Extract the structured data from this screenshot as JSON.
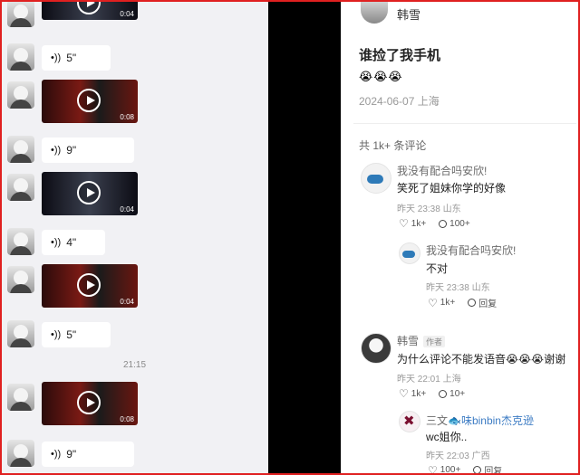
{
  "chat": {
    "messages": [
      {
        "type": "video",
        "duration": "0:04",
        "style": "dark"
      },
      {
        "type": "voice",
        "label": "5\""
      },
      {
        "type": "video",
        "duration": "0:08",
        "style": "red"
      },
      {
        "type": "voice",
        "label": "9\""
      },
      {
        "type": "video",
        "duration": "0:04",
        "style": "dark"
      },
      {
        "type": "voice",
        "label": "4\""
      },
      {
        "type": "video",
        "duration": "0:04",
        "style": "red"
      },
      {
        "type": "voice",
        "label": "5\""
      },
      {
        "type": "video",
        "duration": "0:08",
        "style": "red"
      },
      {
        "type": "voice",
        "label": "9\""
      }
    ],
    "timestamp": "21:15"
  },
  "post": {
    "author": "韩雪",
    "title": "谁捡了我手机",
    "emoji": "😭😭😭",
    "meta": "2024-06-07 上海",
    "comment_count": "共 1k+ 条评论",
    "comments": [
      {
        "name": "我没有配合吗安欣!",
        "text": "笑死了姐妹你学的好像",
        "meta": "昨天 23:38 山东",
        "likes": "1k+",
        "replies": "100+"
      },
      {
        "name": "我没有配合吗安欣!",
        "text": "不对",
        "meta": "昨天 23:38 山东",
        "likes": "1k+",
        "replies": "回复"
      },
      {
        "name": "韩雪",
        "author_tag": "作者",
        "text": "为什么评论不能发语音😭😭😭谢谢",
        "meta": "昨天 22:01 上海",
        "likes": "1k+",
        "replies": "10+"
      },
      {
        "name": "三文",
        "name_extra": "🐟味binbin杰克逊",
        "text": "wc姐你..",
        "meta": "昨天 22:03 广西",
        "likes": "100+",
        "replies": "回复"
      }
    ]
  },
  "colors": {
    "frame_border": "#e02020",
    "chat_bg": "#f1f1f4",
    "divider": "#000000"
  }
}
